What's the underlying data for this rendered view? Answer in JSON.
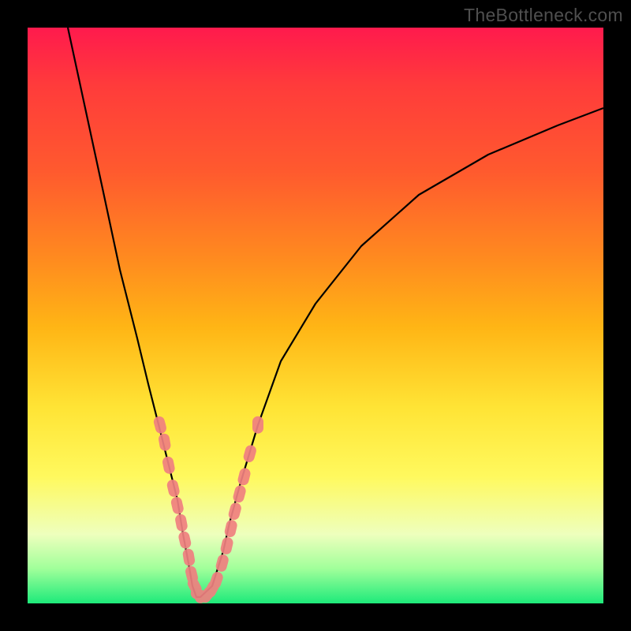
{
  "watermark": {
    "text": "TheBottleneck.com"
  },
  "chart_data": {
    "type": "line",
    "title": "",
    "xlabel": "",
    "ylabel": "",
    "xlim": [
      0,
      100
    ],
    "ylim": [
      0,
      100
    ],
    "background_gradient": {
      "top": "#ff1a4d",
      "bottom": "#1dea7a",
      "stops": [
        {
          "pos": 0,
          "color": "#ff1a4d"
        },
        {
          "pos": 10,
          "color": "#ff3b3b"
        },
        {
          "pos": 25,
          "color": "#ff5a2e"
        },
        {
          "pos": 40,
          "color": "#ff8a1f"
        },
        {
          "pos": 52,
          "color": "#ffb515"
        },
        {
          "pos": 66,
          "color": "#ffe435"
        },
        {
          "pos": 78,
          "color": "#fff95e"
        },
        {
          "pos": 88,
          "color": "#eeffbd"
        },
        {
          "pos": 94,
          "color": "#a0ff9a"
        },
        {
          "pos": 100,
          "color": "#1dea7a"
        }
      ]
    },
    "series": [
      {
        "name": "bottleneck-curve",
        "color": "#000000",
        "x": [
          7,
          10,
          13,
          16,
          19,
          21,
          23,
          24.5,
          26,
          27,
          28,
          28.7,
          29.3,
          30,
          32,
          34,
          35,
          37,
          40,
          44,
          50,
          58,
          68,
          80,
          92,
          100
        ],
        "y": [
          100,
          86,
          72,
          58,
          46,
          38,
          30,
          24,
          18,
          12,
          7,
          3,
          1,
          1,
          3,
          9,
          14,
          21,
          31,
          42,
          52,
          62,
          71,
          78,
          83,
          86
        ]
      }
    ],
    "overlay_markers": [
      {
        "name": "pink-blobs",
        "color": "#f08080",
        "note": "segments/dots highlighted along both branches of the V",
        "points_xy": [
          [
            23,
            31
          ],
          [
            23.8,
            28
          ],
          [
            24.5,
            24
          ],
          [
            25.3,
            20
          ],
          [
            26,
            17
          ],
          [
            26.7,
            14
          ],
          [
            27.3,
            11
          ],
          [
            28,
            8
          ],
          [
            28.5,
            5
          ],
          [
            29,
            3
          ],
          [
            29.8,
            1.5
          ],
          [
            30.5,
            1.2
          ],
          [
            31.2,
            1.5
          ],
          [
            32,
            2.5
          ],
          [
            32.8,
            4
          ],
          [
            33.8,
            7
          ],
          [
            34.6,
            10
          ],
          [
            35.3,
            13
          ],
          [
            36,
            16
          ],
          [
            36.8,
            19
          ],
          [
            37.6,
            22
          ],
          [
            38.6,
            26
          ],
          [
            40,
            31
          ]
        ]
      }
    ]
  }
}
